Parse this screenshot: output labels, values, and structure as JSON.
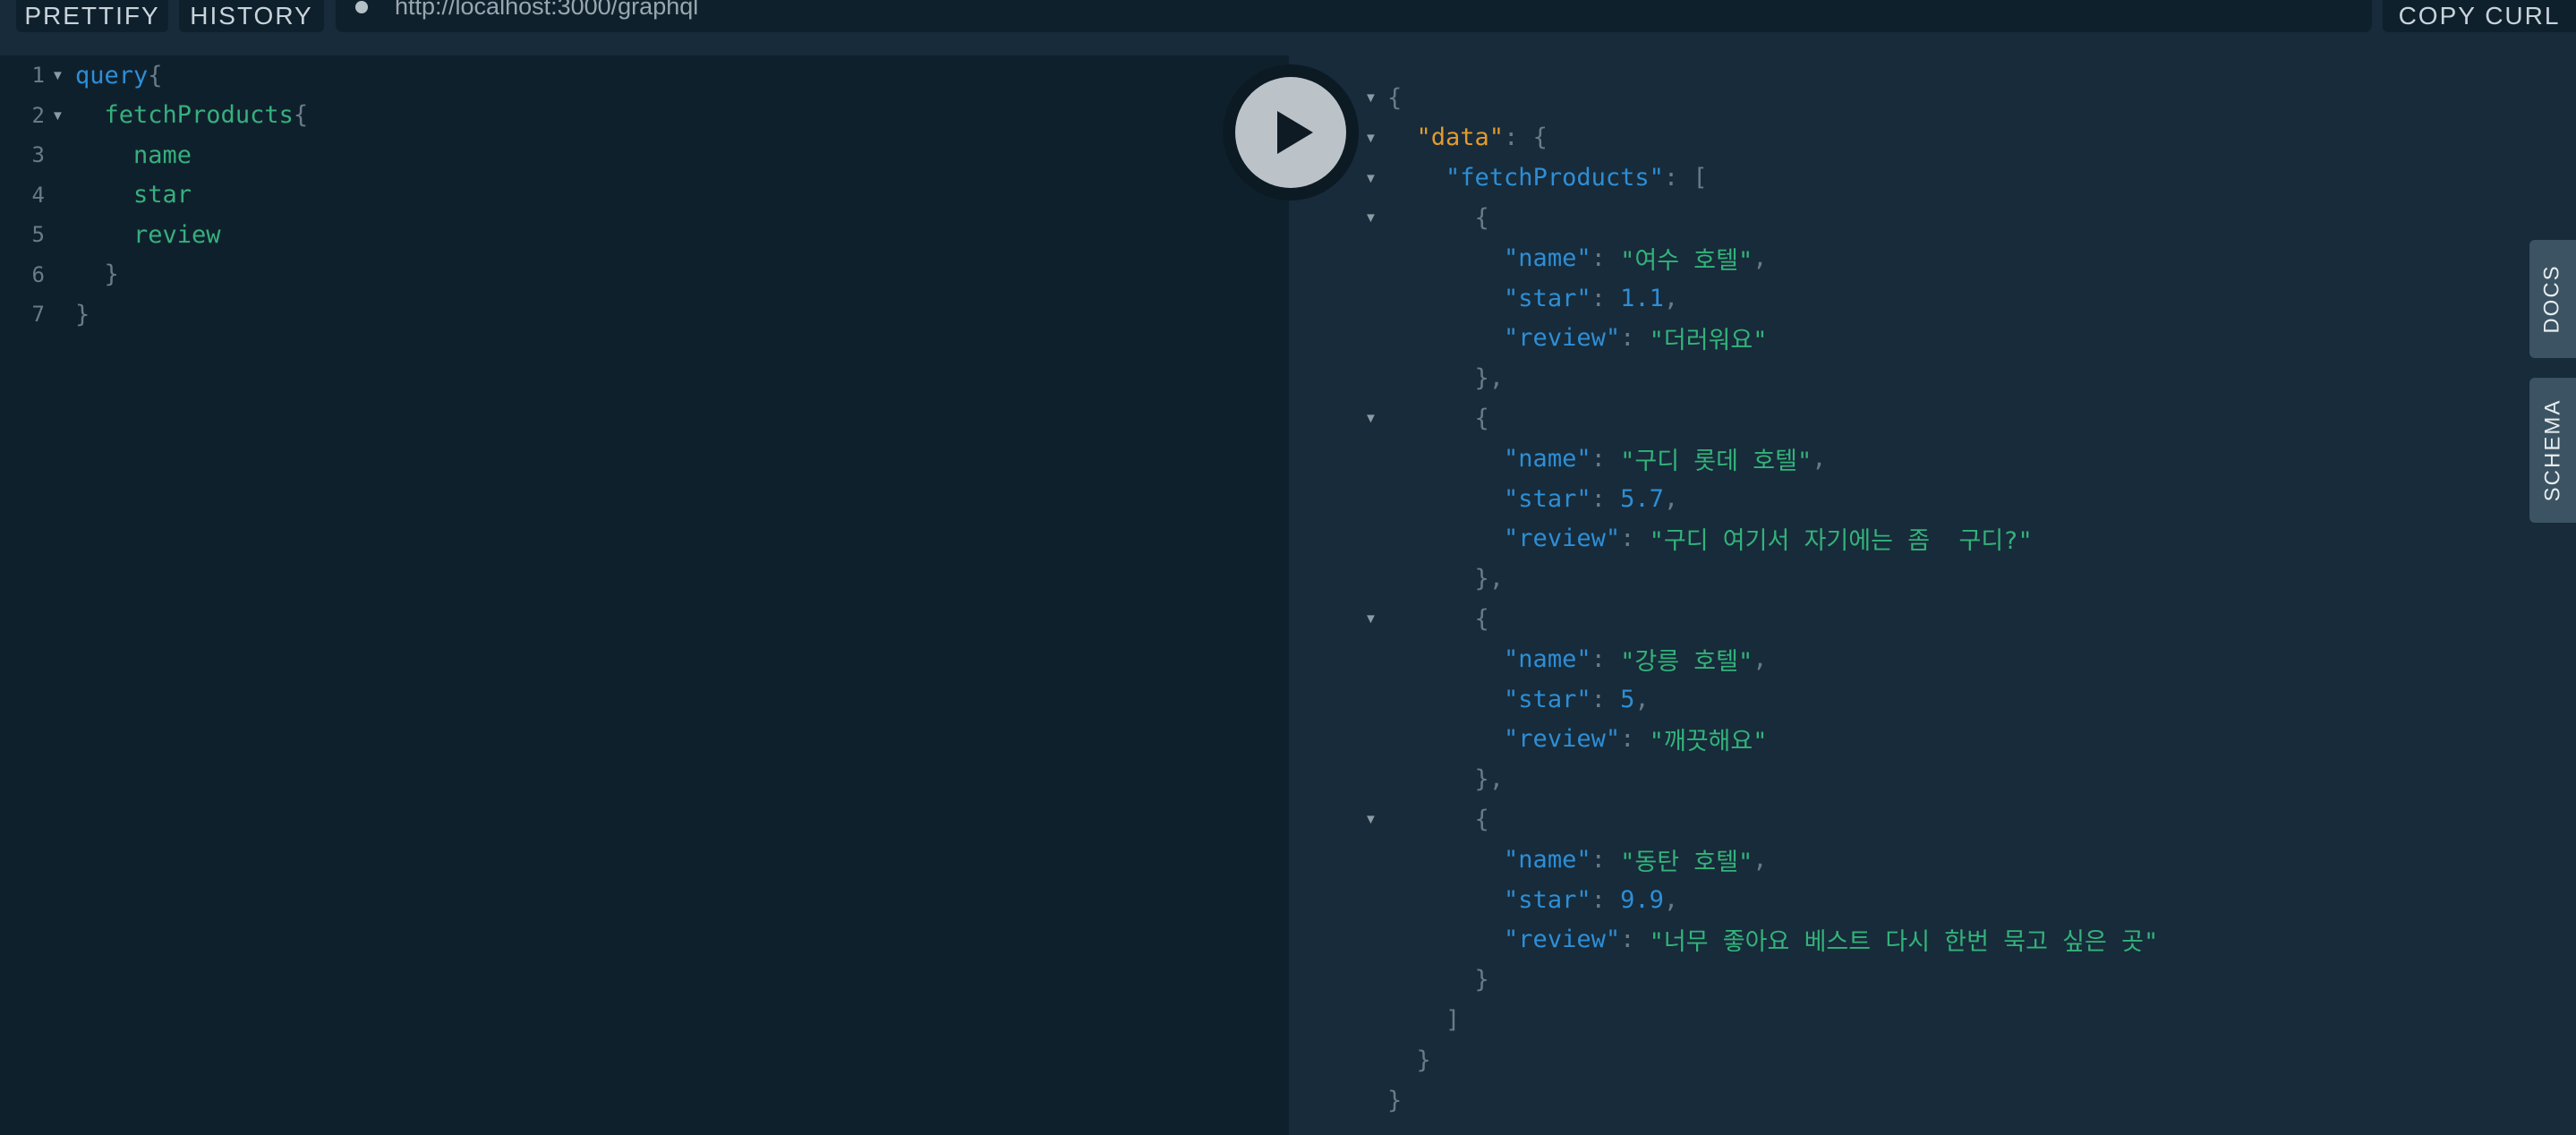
{
  "toolbar": {
    "prettify": "PRETTIFY",
    "history": "HISTORY",
    "url": "http://localhost:3000/graphql",
    "copy_curl": "COPY CURL"
  },
  "editor": {
    "lines": [
      {
        "num": "1",
        "indent": "",
        "parts": [
          [
            "kw",
            "query"
          ],
          [
            "br",
            "{"
          ]
        ]
      },
      {
        "num": "2",
        "indent": "  ",
        "parts": [
          [
            "fn",
            "fetchProducts"
          ],
          [
            "br",
            "{"
          ]
        ]
      },
      {
        "num": "3",
        "indent": "    ",
        "parts": [
          [
            "fn",
            "name"
          ]
        ]
      },
      {
        "num": "4",
        "indent": "    ",
        "parts": [
          [
            "fn",
            "star"
          ]
        ]
      },
      {
        "num": "5",
        "indent": "    ",
        "parts": [
          [
            "fn",
            "review"
          ]
        ]
      },
      {
        "num": "6",
        "indent": "  ",
        "parts": [
          [
            "br",
            "}"
          ]
        ]
      },
      {
        "num": "7",
        "indent": "",
        "parts": [
          [
            "br",
            "}"
          ]
        ]
      }
    ]
  },
  "result": {
    "products": [
      {
        "name": "여수 호텔",
        "star": "1.1",
        "review": "더러워요"
      },
      {
        "name": "구디 롯데 호텔",
        "star": "5.7",
        "review": "구디 여기서 자기에는 좀  구디?"
      },
      {
        "name": "강릉 호텔",
        "star": "5",
        "review": "깨끗해요"
      },
      {
        "name": "동탄 호텔",
        "star": "9.9",
        "review": "너무 좋아요 베스트 다시 한번 묵고 싶은 곳"
      }
    ]
  },
  "side_tabs": {
    "docs": "DOCS",
    "schema": "SCHEMA"
  },
  "colors": {
    "background": "#0f202d",
    "result_background": "#172b3a",
    "keyword": "#2e8ed6",
    "field": "#36b07c",
    "data_key": "#e39a2d"
  },
  "icons": {
    "play": "play-icon",
    "fold": "triangle-down-icon"
  }
}
